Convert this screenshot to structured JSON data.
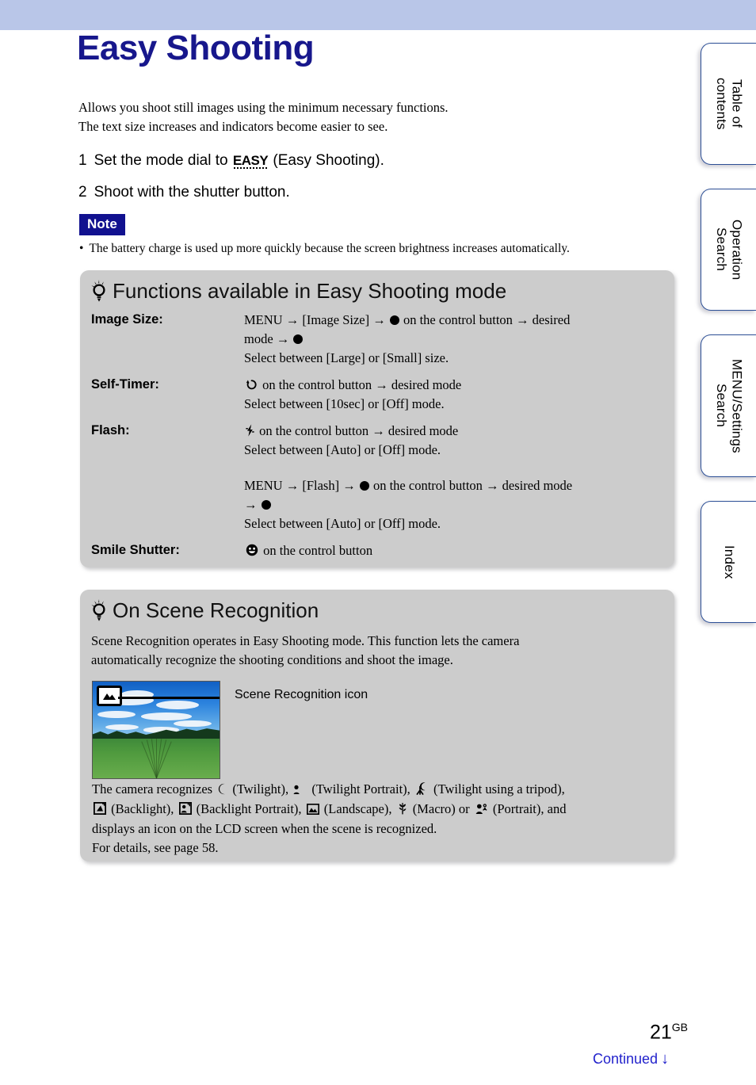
{
  "banner": {
    "color": "#b9c6e8"
  },
  "header": {
    "title": "Easy Shooting",
    "title_color": "#17178c"
  },
  "intro": {
    "line1": "Allows you shoot still images using the minimum necessary functions.",
    "line2": "The text size increases and indicators become easier to see."
  },
  "steps": [
    {
      "num": "1",
      "text_before": "Set the mode dial to ",
      "glyph": "EASY",
      "text_after": " (Easy Shooting)."
    },
    {
      "num": "2",
      "text_before": "Shoot with the shutter button.",
      "glyph": "",
      "text_after": ""
    }
  ],
  "note": {
    "badge": "Note",
    "bullet": "•",
    "text": "The battery charge is used up more quickly because the screen brightness increases automatically."
  },
  "tipbox1": {
    "icon": "lightbulb-icon",
    "heading": "Functions available in Easy Shooting mode",
    "rows": [
      {
        "label": "Image Size:",
        "lines": [
          "MENU → [Image Size] → ● on the control button → desired",
          "mode → ●",
          "Select between [Large] or [Small] size."
        ]
      },
      {
        "label": "Self-Timer:",
        "icon": "self-timer-icon",
        "lines": [
          "↺ on the control button → desired mode",
          "Select between [10sec] or [Off] mode."
        ]
      },
      {
        "label": "Flash:",
        "icon": "flash-icon",
        "lines": [
          "⚡ on the control button → desired mode",
          "Select between [Auto] or [Off] mode."
        ]
      },
      {
        "label": "",
        "lines": [
          "MENU → [Flash] → ● on the control button → desired mode",
          "→ ●",
          "Select between [Auto] or [Off] mode."
        ]
      },
      {
        "label": "Smile Shutter:",
        "icon": "smile-icon",
        "lines": [
          "☺ on the control button"
        ]
      }
    ]
  },
  "tipbox2": {
    "icon": "lightbulb-icon",
    "heading": "On Scene Recognition",
    "body_line1": "Scene Recognition operates in Easy Shooting mode. This function lets the camera",
    "body_line2": "automatically recognize the shooting conditions and shoot the image.",
    "callout_label": "Scene Recognition icon",
    "thumbnail_alt": "landscape-photo-with-sky-clouds-trees-field",
    "recognize": {
      "lead": "The camera recognizes",
      "items": [
        {
          "icon": "twilight-moon-icon",
          "label": "(Twilight),"
        },
        {
          "icon": "twilight-portrait-icon",
          "label": "(Twilight Portrait),"
        },
        {
          "icon": "twilight-tripod-icon",
          "label": "(Twilight using a tripod),"
        },
        {
          "icon": "backlight-icon",
          "label": "(Backlight),"
        },
        {
          "icon": "backlight-portrait-icon",
          "label": "(Backlight Portrait),"
        },
        {
          "icon": "landscape-icon",
          "label": "(Landscape),"
        },
        {
          "icon": "macro-tulip-icon",
          "label": "(Macro) or"
        },
        {
          "icon": "portrait-icon",
          "label": "(Portrait), and"
        }
      ],
      "tail_line1": "displays an icon on the LCD screen when the scene is recognized.",
      "tail_line2": "For details, see page 58."
    }
  },
  "sidebar": {
    "tabs": [
      {
        "label": "Table of\ncontents"
      },
      {
        "label": "Operation\nSearch"
      },
      {
        "label": "MENU/Settings\nSearch"
      },
      {
        "label": "Index"
      }
    ]
  },
  "footer": {
    "page_number": "21",
    "page_suffix": "GB",
    "continued": "Continued",
    "continued_arrow": "↓",
    "continued_color": "#2222cc"
  }
}
